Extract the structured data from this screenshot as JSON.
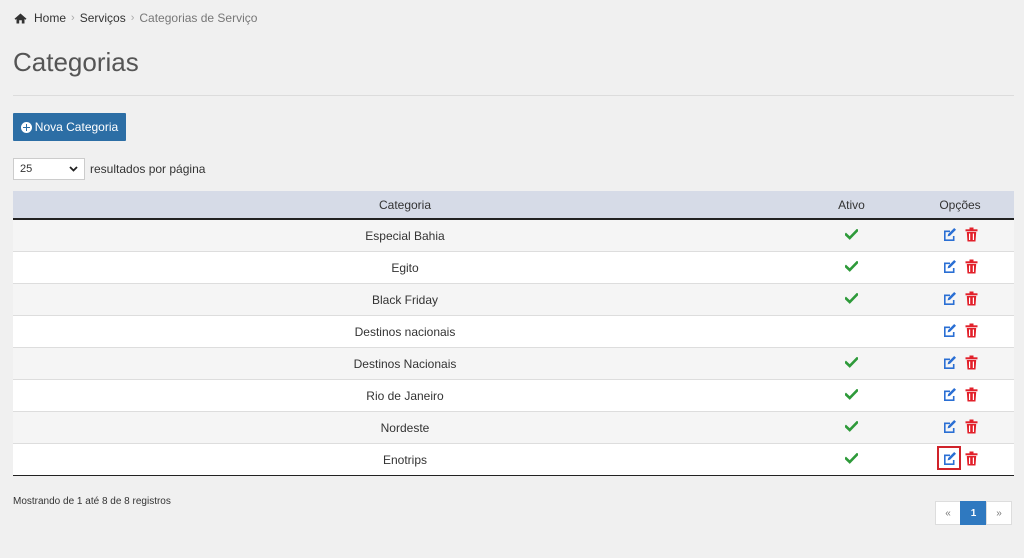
{
  "breadcrumb": {
    "home": "Home",
    "services": "Serviços",
    "current": "Categorias de Serviço"
  },
  "page": {
    "title": "Categorias",
    "new_button": "Nova Categoria"
  },
  "length": {
    "value": "25",
    "label": "resultados por página"
  },
  "table": {
    "headers": {
      "category": "Categoria",
      "active": "Ativo",
      "options": "Opções"
    },
    "rows": [
      {
        "category": "Especial Bahia",
        "active": true
      },
      {
        "category": "Egito",
        "active": true
      },
      {
        "category": "Black Friday",
        "active": true
      },
      {
        "category": "Destinos nacionais",
        "active": false
      },
      {
        "category": "Destinos Nacionais",
        "active": true
      },
      {
        "category": "Rio de Janeiro",
        "active": true
      },
      {
        "category": "Nordeste",
        "active": true
      },
      {
        "category": "Enotrips",
        "active": true
      }
    ]
  },
  "footer": {
    "info": "Mostrando de 1 até 8 de 8 registros",
    "pager": {
      "prev": "«",
      "current": "1",
      "next": "»"
    }
  },
  "colors": {
    "primary": "#2c6ea5",
    "check": "#2e9a3a",
    "edit": "#2a6fd4",
    "delete": "#e2202a",
    "header_bg": "#d6dbe7"
  },
  "icons": {
    "home": "home-icon",
    "plus": "plus-circle-icon",
    "check": "check-icon",
    "edit": "edit-icon",
    "delete": "trash-icon",
    "dropdown": "chevron-down-icon"
  }
}
